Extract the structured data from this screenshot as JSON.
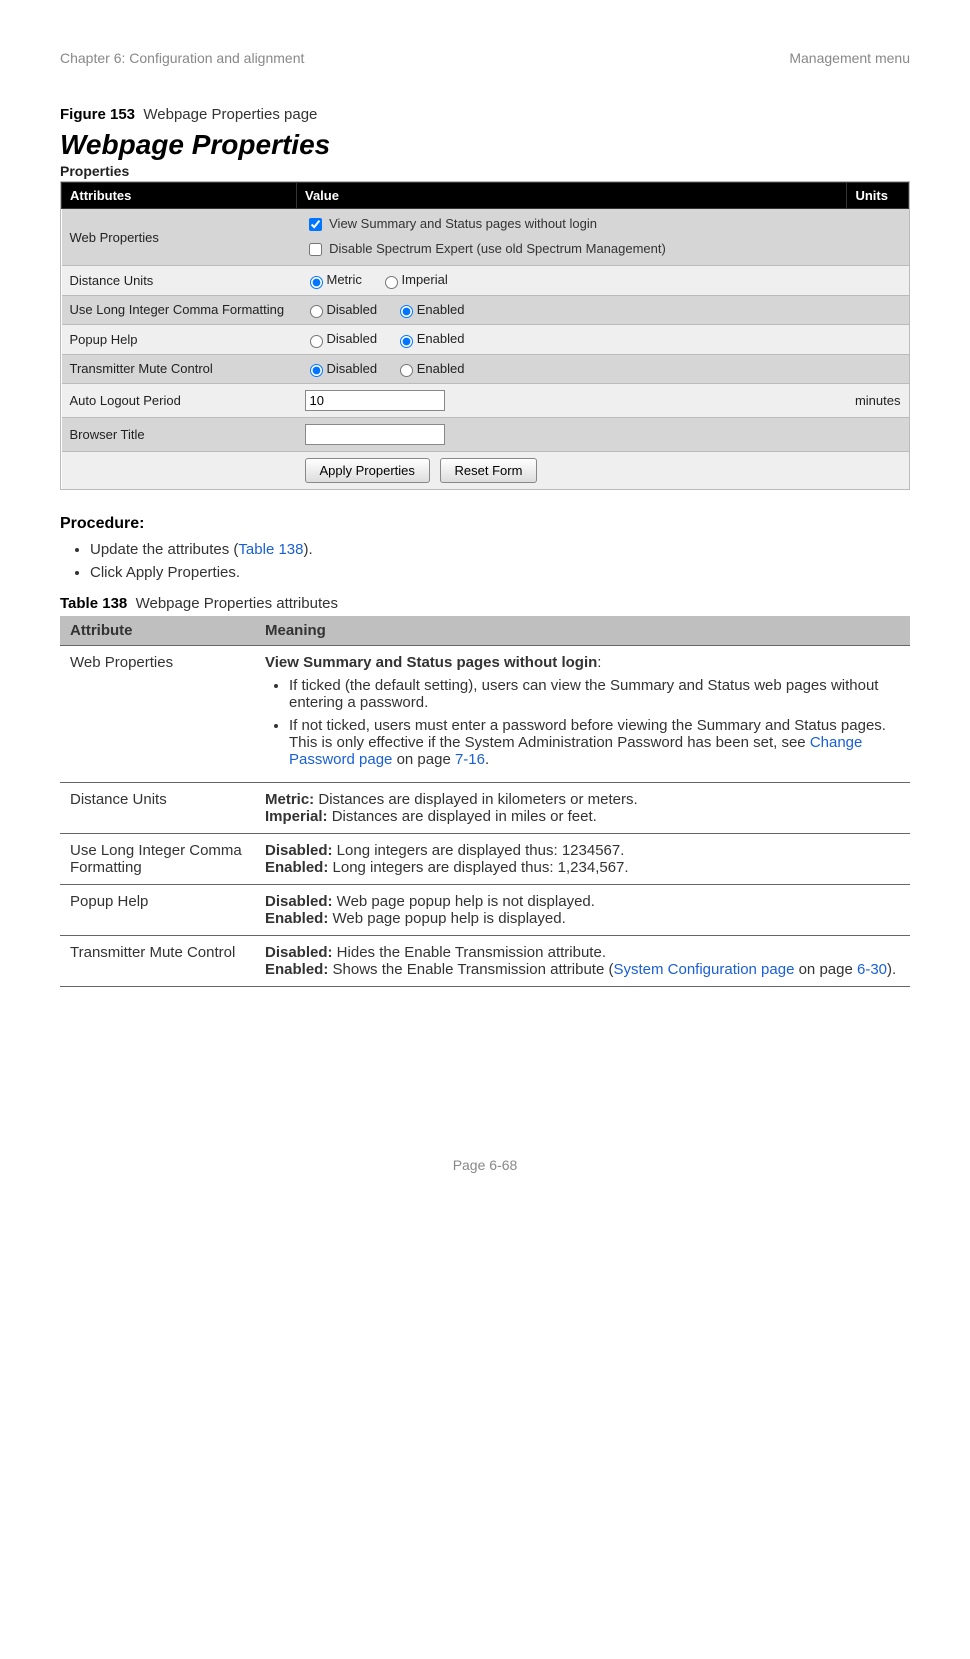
{
  "header": {
    "left": "Chapter 6:  Configuration and alignment",
    "right": "Management menu"
  },
  "figure": {
    "label": "Figure 153",
    "caption": "Webpage Properties page"
  },
  "wp": {
    "title": "Webpage Properties",
    "subtitle": "Properties",
    "headers": {
      "attributes": "Attributes",
      "value": "Value",
      "units": "Units"
    },
    "rows": {
      "web_properties": {
        "label": "Web Properties",
        "opt1": "View Summary and Status pages without login",
        "opt2": "Disable Spectrum Expert (use old Spectrum Management)"
      },
      "distance_units": {
        "label": "Distance Units",
        "metric": "Metric",
        "imperial": "Imperial"
      },
      "long_int": {
        "label": "Use Long Integer Comma Formatting",
        "disabled": "Disabled",
        "enabled": "Enabled"
      },
      "popup_help": {
        "label": "Popup Help",
        "disabled": "Disabled",
        "enabled": "Enabled"
      },
      "tx_mute": {
        "label": "Transmitter Mute Control",
        "disabled": "Disabled",
        "enabled": "Enabled"
      },
      "auto_logout": {
        "label": "Auto Logout Period",
        "value": "10",
        "units": "minutes"
      },
      "browser_title": {
        "label": "Browser Title",
        "value": ""
      }
    },
    "buttons": {
      "apply": "Apply Properties",
      "reset": "Reset Form"
    }
  },
  "procedure": {
    "heading": "Procedure:",
    "item1_a": "Update the attributes (",
    "item1_link": "Table 138",
    "item1_b": ").",
    "item2": "Click Apply Properties."
  },
  "table138": {
    "label": "Table 138",
    "caption": "Webpage Properties attributes",
    "headers": {
      "attr": "Attribute",
      "meaning": "Meaning"
    },
    "rows": {
      "web_props": {
        "attr": "Web Properties",
        "lead_bold": "View Summary and Status pages without login",
        "lead_colon": ":",
        "b1": "If ticked (the default setting), users can view the Summary and Status web pages without entering a password.",
        "b2_a": "If not ticked, users must enter a password before viewing the Summary and Status pages. This is only effective if the System Administration Password has been set, see ",
        "b2_link": "Change Password page",
        "b2_b": " on page ",
        "b2_page": "7-16",
        "b2_c": "."
      },
      "dist": {
        "attr": "Distance Units",
        "l1b": "Metric:",
        "l1": " Distances are displayed in kilometers or meters.",
        "l2b": "Imperial:",
        "l2": " Distances are displayed in miles or feet."
      },
      "long": {
        "attr": "Use Long Integer Comma Formatting",
        "l1b": "Disabled:",
        "l1": " Long integers are displayed thus: 1234567.",
        "l2b": "Enabled:",
        "l2": " Long integers are displayed thus: 1,234,567."
      },
      "popup": {
        "attr": "Popup Help",
        "l1b": "Disabled:",
        "l1": " Web page popup help is not displayed.",
        "l2b": "Enabled:",
        "l2": " Web page popup help is displayed."
      },
      "txmute": {
        "attr": "Transmitter Mute Control",
        "l1b": "Disabled:",
        "l1": " Hides the Enable Transmission attribute.",
        "l2b": "Enabled:",
        "l2a": " Shows the Enable Transmission attribute (",
        "l2link": "System Configuration page",
        "l2b_t": " on page ",
        "l2page": "6-30",
        "l2c": ")."
      }
    }
  },
  "footer": "Page 6-68"
}
